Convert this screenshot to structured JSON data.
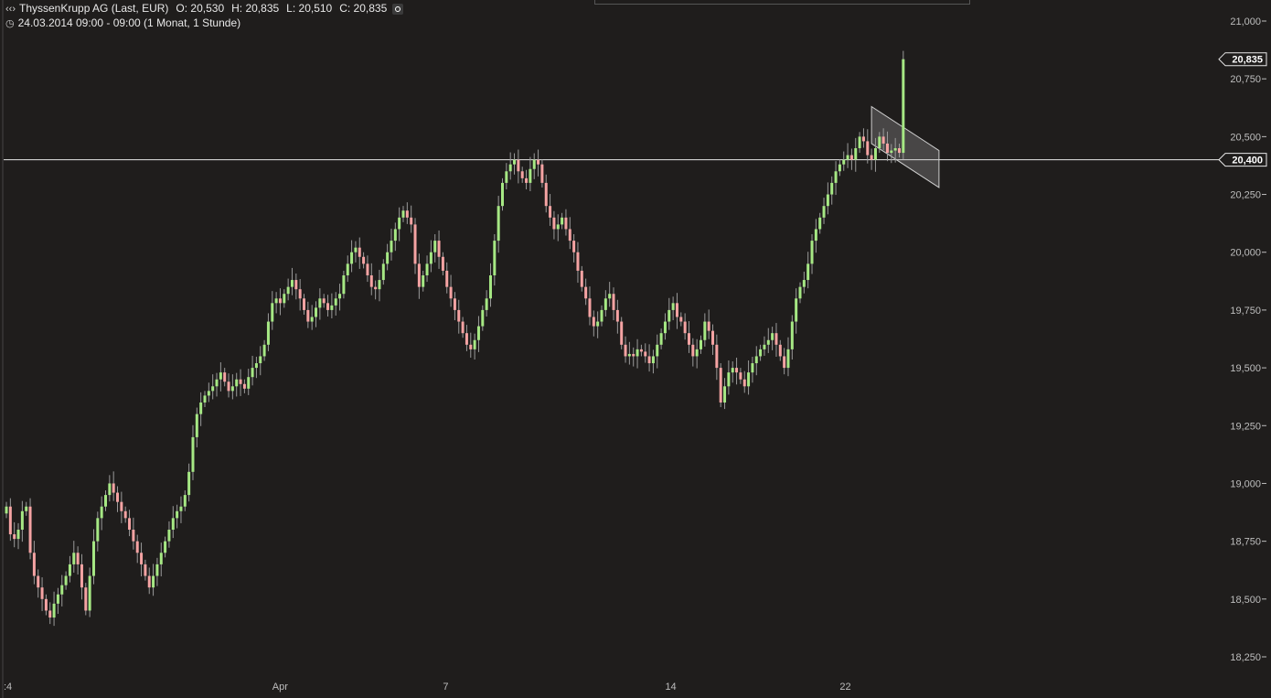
{
  "header": {
    "instrument": "ThyssenKrupp AG (Last, EUR)",
    "open": "O: 20,530",
    "high": "H: 20,835",
    "low": "L: 20,510",
    "close": "C: 20,835",
    "period": "24.03.2014 09:00 - 09:00 (1 Monat, 1 Stunde)"
  },
  "colors": {
    "background": "#1f1d1c",
    "up": "#a6e884",
    "down": "#f5a3a3",
    "grid_text": "#bdbdbd"
  },
  "chart_data": {
    "type": "candlestick",
    "y_ticks": [
      "18,250",
      "18,500",
      "18,750",
      "19,000",
      "19,250",
      "19,500",
      "19,750",
      "20,000",
      "20,250",
      "20,500",
      "20,750",
      "21,000"
    ],
    "y_range": [
      18.2,
      21.05
    ],
    "x_labels": [
      {
        "label": ":4",
        "index": 0
      },
      {
        "label": "Apr",
        "index": 67
      },
      {
        "label": "7",
        "index": 110
      },
      {
        "label": "14",
        "index": 166
      },
      {
        "label": "22",
        "index": 210
      }
    ],
    "last_price_label": "20,835",
    "last_price": 20.835,
    "horizontal_line_label": "20,400",
    "horizontal_line": 20.4,
    "channel": {
      "start_index": 218,
      "end_index": 235,
      "upper": [
        20.63,
        20.44
      ],
      "lower": [
        20.47,
        20.28
      ]
    },
    "closes": [
      18.9,
      18.78,
      18.76,
      18.8,
      18.88,
      18.9,
      18.7,
      18.6,
      18.55,
      18.5,
      18.45,
      18.42,
      18.48,
      18.52,
      18.56,
      18.6,
      18.65,
      18.7,
      18.65,
      18.55,
      18.45,
      18.6,
      18.75,
      18.85,
      18.9,
      18.95,
      19.0,
      18.96,
      18.92,
      18.88,
      18.85,
      18.8,
      18.75,
      18.7,
      18.65,
      18.6,
      18.55,
      18.6,
      18.65,
      18.7,
      18.75,
      18.8,
      18.85,
      18.88,
      18.9,
      18.95,
      19.05,
      19.2,
      19.3,
      19.35,
      19.38,
      19.4,
      19.42,
      19.45,
      19.48,
      19.44,
      19.4,
      19.42,
      19.45,
      19.43,
      19.41,
      19.46,
      19.5,
      19.52,
      19.55,
      19.6,
      19.7,
      19.78,
      19.8,
      19.78,
      19.82,
      19.85,
      19.88,
      19.84,
      19.8,
      19.75,
      19.7,
      19.72,
      19.76,
      19.8,
      19.78,
      19.75,
      19.77,
      19.8,
      19.82,
      19.9,
      19.95,
      20.0,
      20.02,
      19.98,
      19.95,
      19.9,
      19.85,
      19.84,
      19.88,
      19.95,
      20.0,
      20.05,
      20.1,
      20.15,
      20.18,
      20.15,
      20.12,
      19.95,
      19.85,
      19.9,
      19.95,
      20.0,
      20.05,
      19.98,
      19.92,
      19.85,
      19.8,
      19.75,
      19.7,
      19.65,
      19.6,
      19.58,
      19.62,
      19.68,
      19.75,
      19.8,
      19.9,
      20.05,
      20.2,
      20.3,
      20.35,
      20.38,
      20.4,
      20.35,
      20.32,
      20.3,
      20.36,
      20.4,
      20.38,
      20.3,
      20.2,
      20.15,
      20.1,
      20.12,
      20.15,
      20.1,
      20.05,
      20.0,
      19.92,
      19.85,
      19.8,
      19.72,
      19.68,
      19.7,
      19.75,
      19.8,
      19.82,
      19.75,
      19.7,
      19.6,
      19.55,
      19.56,
      19.55,
      19.58,
      19.57,
      19.55,
      19.52,
      19.55,
      19.6,
      19.65,
      19.7,
      19.75,
      19.78,
      19.72,
      19.7,
      19.65,
      19.6,
      19.55,
      19.58,
      19.62,
      19.7,
      19.66,
      19.6,
      19.5,
      19.35,
      19.42,
      19.48,
      19.5,
      19.48,
      19.45,
      19.42,
      19.48,
      19.52,
      19.55,
      19.58,
      19.6,
      19.62,
      19.65,
      19.6,
      19.55,
      19.5,
      19.58,
      19.7,
      19.8,
      19.85,
      19.88,
      19.95,
      20.05,
      20.1,
      20.15,
      20.2,
      20.25,
      20.3,
      20.35,
      20.38,
      20.4,
      20.42,
      20.4,
      20.45,
      20.5,
      20.48,
      20.42,
      20.4,
      20.45,
      20.5,
      20.47,
      20.43,
      20.44,
      20.45,
      20.43,
      20.835
    ]
  }
}
